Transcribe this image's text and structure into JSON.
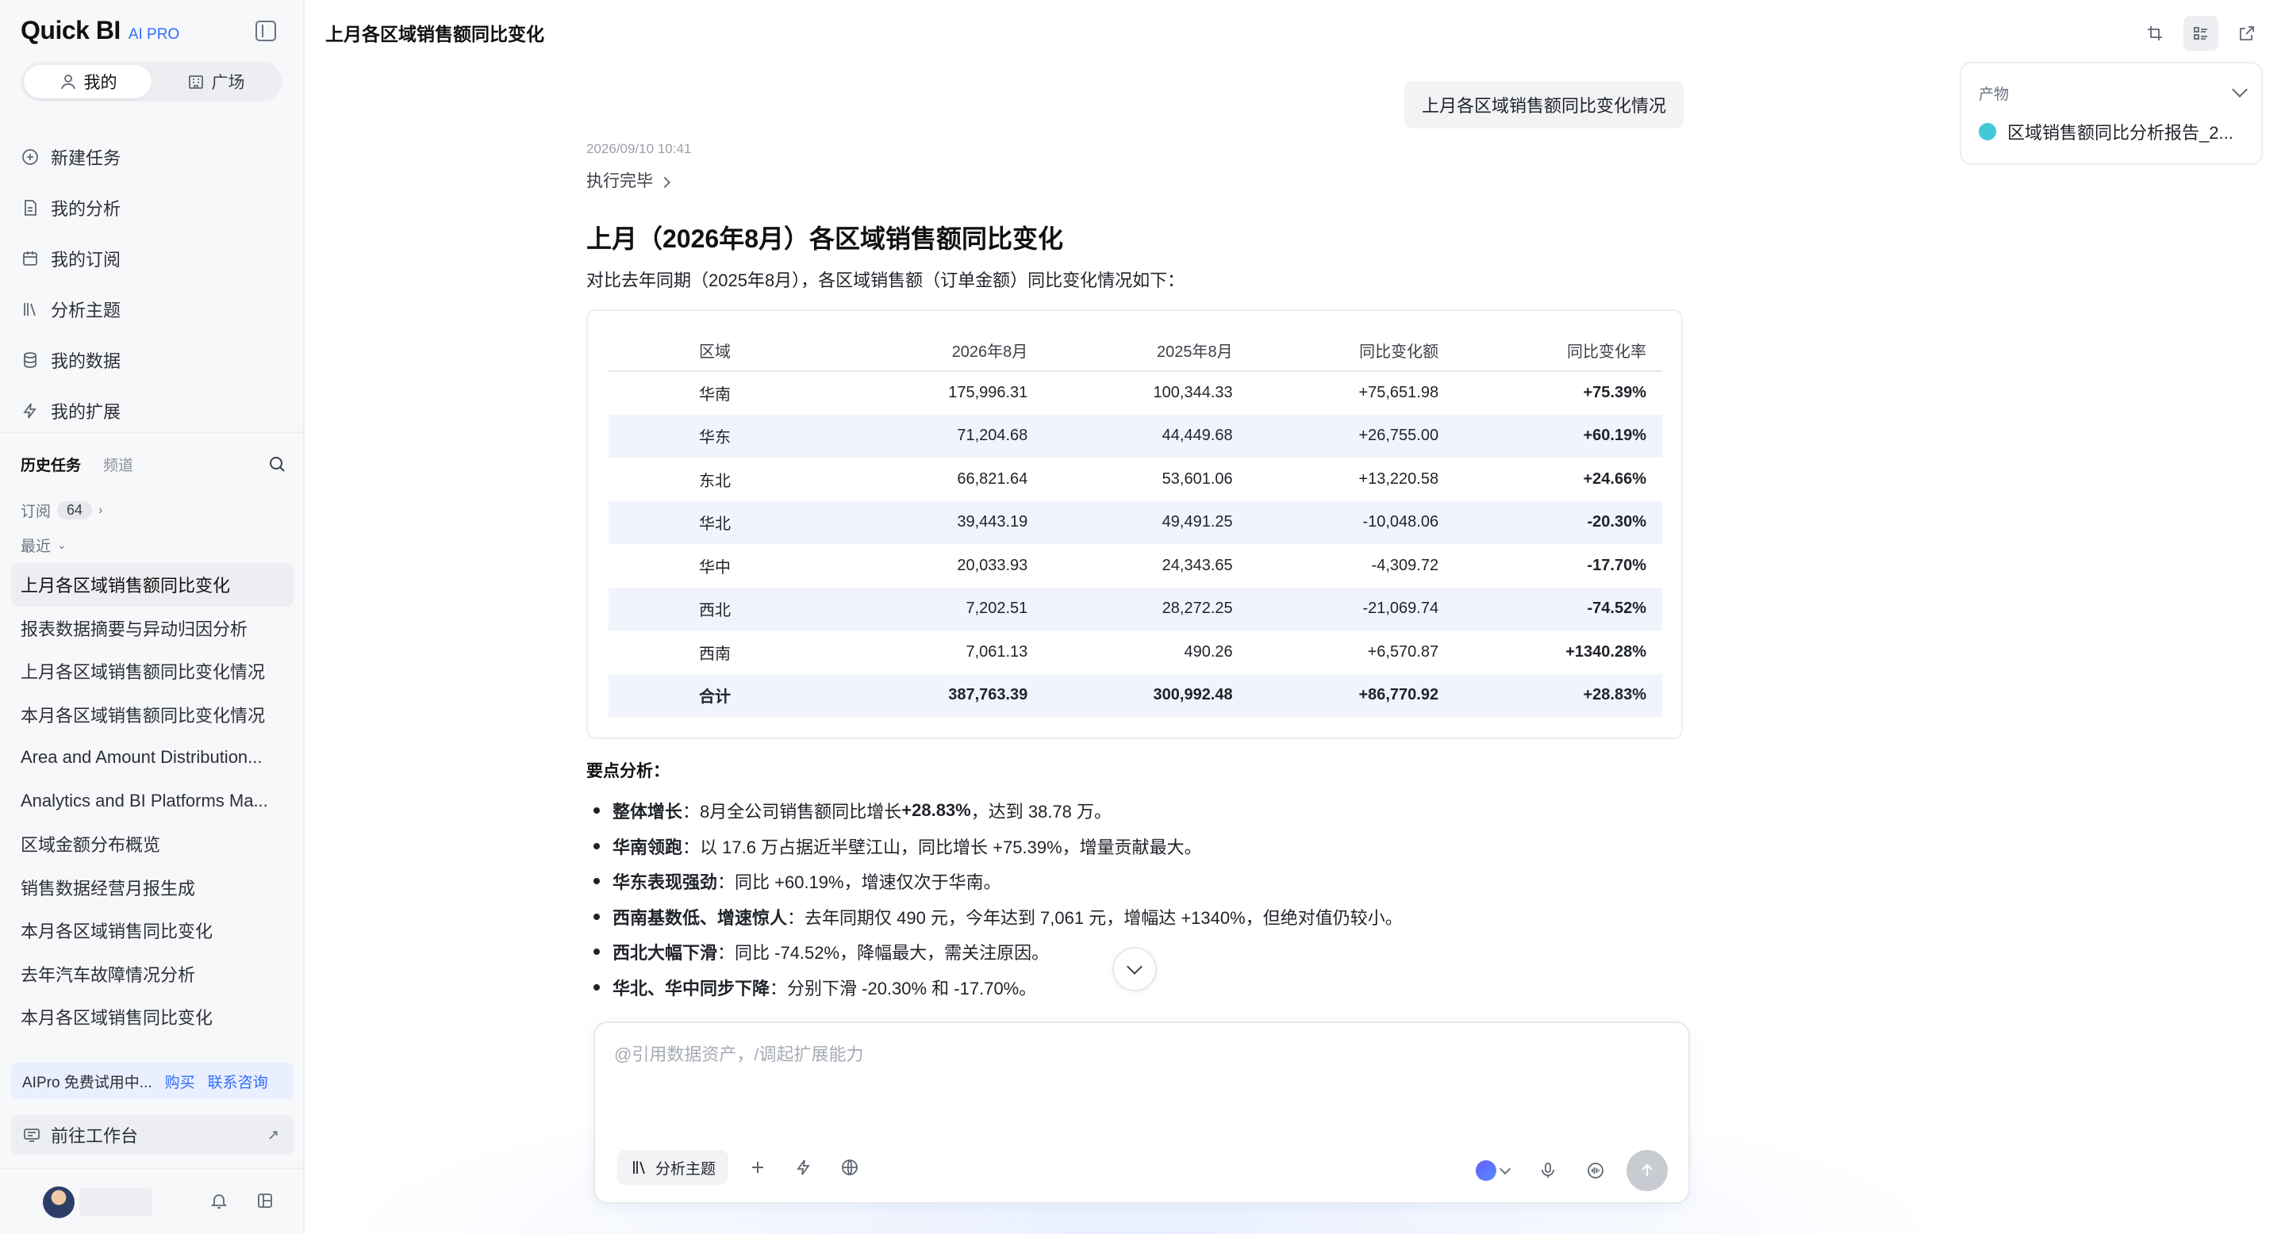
{
  "brand": {
    "name": "Quick BI",
    "badge": "AI PRO"
  },
  "segment": {
    "mine": "我的",
    "plaza": "广场"
  },
  "nav": [
    {
      "label": "新建任务",
      "icon": "plus-circle-icon"
    },
    {
      "label": "我的分析",
      "icon": "file-icon"
    },
    {
      "label": "我的订阅",
      "icon": "calendar-icon"
    },
    {
      "label": "分析主题",
      "icon": "books-icon"
    },
    {
      "label": "我的数据",
      "icon": "database-icon"
    },
    {
      "label": "我的扩展",
      "icon": "lightning-icon"
    }
  ],
  "history": {
    "tab_active": "历史任务",
    "tab_other": "频道",
    "subscribe_label": "订阅",
    "subscribe_count": "64",
    "recent_label": "最近",
    "items": [
      "上月各区域销售额同比变化",
      "报表数据摘要与异动归因分析",
      "上月各区域销售额同比变化情况",
      "本月各区域销售额同比变化情况",
      "Area and Amount Distribution...",
      "Analytics and BI Platforms Ma...",
      "区域金额分布概览",
      "销售数据经营月报生成",
      "本月各区域销售同比变化",
      "去年汽车故障情况分析",
      "本月各区域销售同比变化"
    ]
  },
  "promo": {
    "text": "AIPro 免费试用中...",
    "buy": "购买",
    "contact": "联系咨询"
  },
  "workbench": {
    "label": "前往工作台",
    "arrow": "↗"
  },
  "header": {
    "title": "上月各区域销售额同比变化"
  },
  "user_message": "上月各区域销售额同比变化情况",
  "artifact": {
    "head": "产物",
    "item": "区域销售额同比分析报告_2..."
  },
  "answer": {
    "time": "2026/09/10 10:41",
    "status": "执行完毕",
    "title": "上月（2026年8月）各区域销售额同比变化",
    "intro": "对比去年同期（2025年8月），各区域销售额（订单金额）同比变化情况如下：",
    "table": {
      "headers": [
        "区域",
        "2026年8月",
        "2025年8月",
        "同比变化额",
        "同比变化率"
      ],
      "rows": [
        [
          "华南",
          "175,996.31",
          "100,344.33",
          "+75,651.98",
          "+75.39%"
        ],
        [
          "华东",
          "71,204.68",
          "44,449.68",
          "+26,755.00",
          "+60.19%"
        ],
        [
          "东北",
          "66,821.64",
          "53,601.06",
          "+13,220.58",
          "+24.66%"
        ],
        [
          "华北",
          "39,443.19",
          "49,491.25",
          "-10,048.06",
          "-20.30%"
        ],
        [
          "华中",
          "20,033.93",
          "24,343.65",
          "-4,309.72",
          "-17.70%"
        ],
        [
          "西北",
          "7,202.51",
          "28,272.25",
          "-21,069.74",
          "-74.52%"
        ],
        [
          "西南",
          "7,061.13",
          "490.26",
          "+6,570.87",
          "+1340.28%"
        ]
      ],
      "total": [
        "合计",
        "387,763.39",
        "300,992.48",
        "+86,770.92",
        "+28.83%"
      ]
    },
    "points_title": "要点分析：",
    "points": [
      {
        "bold": "整体增长",
        "text": "：8月全公司销售额同比增长 ",
        "bold2": "+28.83%",
        "text2": "，达到 38.78 万。"
      },
      {
        "bold": "华南领跑",
        "text": "：以 17.6 万占据近半壁江山，同比增长 +75.39%，增量贡献最大。",
        "bold2": "",
        "text2": ""
      },
      {
        "bold": "华东表现强劲",
        "text": "：同比 +60.19%，增速仅次于华南。",
        "bold2": "",
        "text2": ""
      },
      {
        "bold": "西南基数低、增速惊人",
        "text": "：去年同期仅 490 元，今年达到 7,061 元，增幅达 +1340%，但绝对值仍较小。",
        "bold2": "",
        "text2": ""
      },
      {
        "bold": "西北大幅下滑",
        "text": "：同比 -74.52%，降幅最大，需关注原因。",
        "bold2": "",
        "text2": ""
      },
      {
        "bold": "华北、华中同步下降",
        "text": "：分别下滑 -20.30% 和 -17.70%。",
        "bold2": "",
        "text2": ""
      }
    ]
  },
  "composer": {
    "placeholder": "@引用数据资产，/调起扩展能力",
    "topic_label": "分析主题"
  },
  "colors": {
    "accent": "#2f6bff",
    "table_stripe": "#f1f4fc",
    "sidebar_bg": "#f7f8fa"
  }
}
